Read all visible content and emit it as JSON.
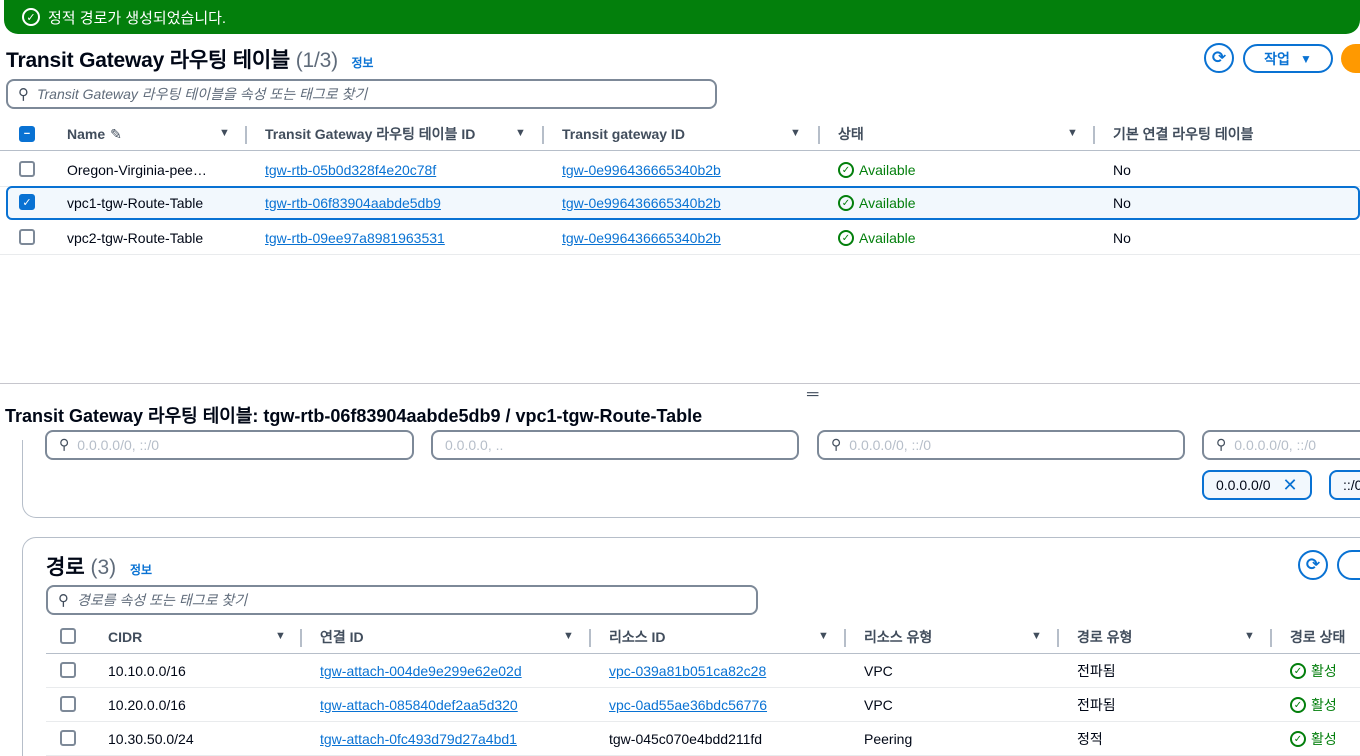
{
  "flash": {
    "message": "정적 경로가 생성되었습니다."
  },
  "top": {
    "title": "Transit Gateway 라우팅 테이블",
    "count": "(1/3)",
    "info": "정보",
    "actions_label": "작업",
    "search_placeholder": "Transit Gateway 라우팅 테이블을 속성 또는 태그로 찾기",
    "columns": [
      "Name",
      "Transit Gateway 라우팅 테이블 ID",
      "Transit gateway ID",
      "상태",
      "기본 연결 라우팅 테이블"
    ],
    "rows": [
      {
        "name": "Oregon-Virginia-pee…",
        "rtb": "tgw-rtb-05b0d328f4e20c78f",
        "tgw": "tgw-0e996436665340b2b",
        "status": "Available",
        "default": "No",
        "selected": false
      },
      {
        "name": "vpc1-tgw-Route-Table",
        "rtb": "tgw-rtb-06f83904aabde5db9",
        "tgw": "tgw-0e996436665340b2b",
        "status": "Available",
        "default": "No",
        "selected": true
      },
      {
        "name": "vpc2-tgw-Route-Table",
        "rtb": "tgw-rtb-09ee97a8981963531",
        "tgw": "tgw-0e996436665340b2b",
        "status": "Available",
        "default": "No",
        "selected": false
      }
    ]
  },
  "detail": {
    "title": "Transit Gateway 라우팅 테이블: tgw-rtb-06f83904aabde5db9 / vpc1-tgw-Route-Table",
    "filter_inputs": [
      "0.0.0.0/0, ::/0",
      "0.0.0.0, ..",
      "0.0.0.0/0, ::/0",
      "0.0.0.0/0, ::/0"
    ],
    "tokens": [
      "0.0.0.0/0",
      "::/0"
    ]
  },
  "routes": {
    "title": "경로",
    "count": "(3)",
    "info": "정보",
    "search_placeholder": "경로를 속성 또는 태그로 찾기",
    "columns": [
      "CIDR",
      "연결 ID",
      "리소스 ID",
      "리소스 유형",
      "경로 유형",
      "경로 상태"
    ],
    "rows": [
      {
        "cidr": "10.10.0.0/16",
        "attach": "tgw-attach-004de9e299e62e02d",
        "resource": "vpc-039a81b051ca82c28",
        "resource_link": true,
        "type": "VPC",
        "route_type": "전파됨",
        "state": "활성"
      },
      {
        "cidr": "10.20.0.0/16",
        "attach": "tgw-attach-085840def2aa5d320",
        "resource": "vpc-0ad55ae36bdc56776",
        "resource_link": true,
        "type": "VPC",
        "route_type": "전파됨",
        "state": "활성"
      },
      {
        "cidr": "10.30.50.0/24",
        "attach": "tgw-attach-0fc493d79d27a4bd1",
        "resource": "tgw-045c070e4bdd211fd",
        "resource_link": false,
        "type": "Peering",
        "route_type": "정적",
        "state": "활성"
      }
    ]
  },
  "colors": {
    "accent": "#0972d3",
    "success": "#037f0c",
    "flash_bg": "#037f0c",
    "action_orange": "#ff9900"
  }
}
